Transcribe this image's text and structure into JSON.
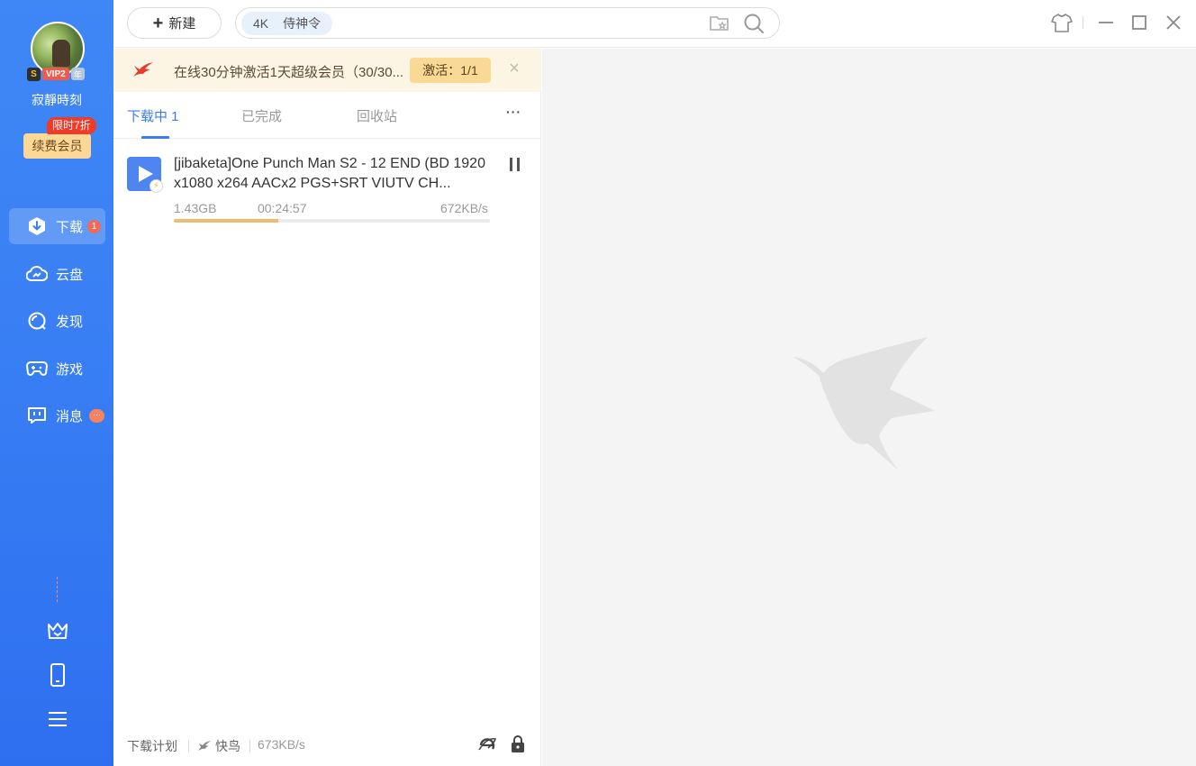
{
  "sidebar": {
    "username": "寂靜時刻",
    "vip": {
      "s_label": "S",
      "tag": "VIP2",
      "year": "年"
    },
    "promo_tag": "限时7折",
    "renew_label": "续费会员",
    "nav": [
      {
        "label": "下载",
        "icon": "download-icon",
        "badge": "1",
        "active": true
      },
      {
        "label": "云盘",
        "icon": "cloud-icon"
      },
      {
        "label": "发现",
        "icon": "discover-icon"
      },
      {
        "label": "游戏",
        "icon": "gamepad-icon"
      },
      {
        "label": "消息",
        "icon": "message-icon",
        "badge": "···"
      }
    ],
    "bottom_icons": [
      "crown-icon",
      "phone-icon",
      "menu-icon"
    ],
    "accent": "#3a80f4"
  },
  "topbar": {
    "new_label": "新建",
    "search_chip": {
      "tag": "4K",
      "text": "侍神令"
    },
    "icons": [
      "folder-star-icon",
      "search-icon"
    ],
    "window_controls": [
      "skin-icon",
      "minimize-icon",
      "maximize-icon",
      "close-icon"
    ]
  },
  "banner": {
    "text": "在线30分钟激活1天超级会员（30/30...",
    "button": "激活：1/1",
    "close": "×"
  },
  "tabs": [
    {
      "label": "下载中 1",
      "active": true
    },
    {
      "label": "已完成"
    },
    {
      "label": "回收站"
    }
  ],
  "more_label": "···",
  "tasks": [
    {
      "title": "[jibaketa]One Punch Man S2 - 12 END (BD 1920x1080 x264 AACx2 PGS+SRT VIUTV CH...",
      "size": "1.43GB",
      "remaining": "00:24:57",
      "speed": "672KB/s",
      "progress_percent": 33
    }
  ],
  "status_bar": {
    "plan": "下载计划",
    "mode": "快鸟",
    "speed": "673KB/s"
  },
  "colors": {
    "accent_blue": "#3b7cf2",
    "banner_bg": "#fdf5e4",
    "progress": "#e9bf72"
  }
}
